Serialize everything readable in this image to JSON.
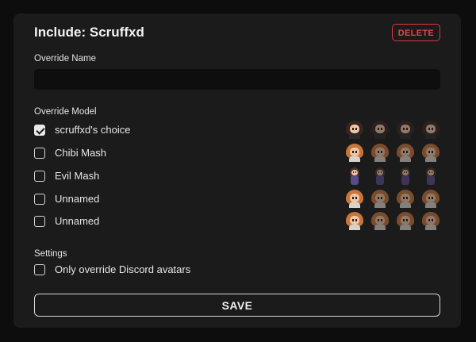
{
  "panel": {
    "title": "Include: Scruffxd",
    "delete_label": "DELETE"
  },
  "override_name": {
    "label": "Override Name",
    "value": "",
    "placeholder": ""
  },
  "override_model": {
    "label": "Override Model",
    "options": [
      {
        "label": "scruffxd's choice",
        "checked": true,
        "avatar_style": "dark-hair"
      },
      {
        "label": "Chibi Mash",
        "checked": false,
        "avatar_style": "orange-hair"
      },
      {
        "label": "Evil Mash",
        "checked": false,
        "avatar_style": "small-purple"
      },
      {
        "label": "Unnamed",
        "checked": false,
        "avatar_style": "orange-hair"
      },
      {
        "label": "Unnamed",
        "checked": false,
        "avatar_style": "orange-hair"
      }
    ]
  },
  "settings": {
    "label": "Settings",
    "only_discord_label": "Only override Discord avatars",
    "only_discord_checked": false
  },
  "save_label": "SAVE",
  "colors": {
    "background": "#0d0d0d",
    "panel": "#1b1b1b",
    "delete_accent": "#d9363e",
    "input_bg": "#0e0e0e"
  }
}
